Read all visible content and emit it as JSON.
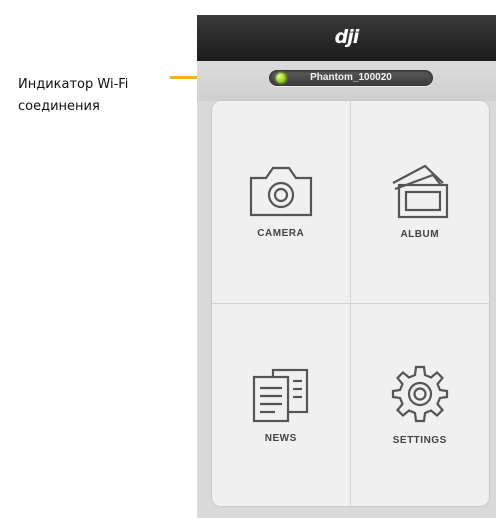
{
  "annotation": {
    "text_line1": "Индикатор Wi-Fi",
    "text_line2": "соединения",
    "line_color": "#f2b417"
  },
  "app": {
    "logo_text": "dji",
    "wifi": {
      "network_name": "Phantom_100020",
      "indicator_color": "#8fd11c"
    },
    "tiles": [
      {
        "label": "CAMERA",
        "icon": "camera-icon"
      },
      {
        "label": "ALBUM",
        "icon": "album-icon"
      },
      {
        "label": "NEWS",
        "icon": "news-icon"
      },
      {
        "label": "SETTINGS",
        "icon": "settings-gear-icon"
      }
    ]
  }
}
